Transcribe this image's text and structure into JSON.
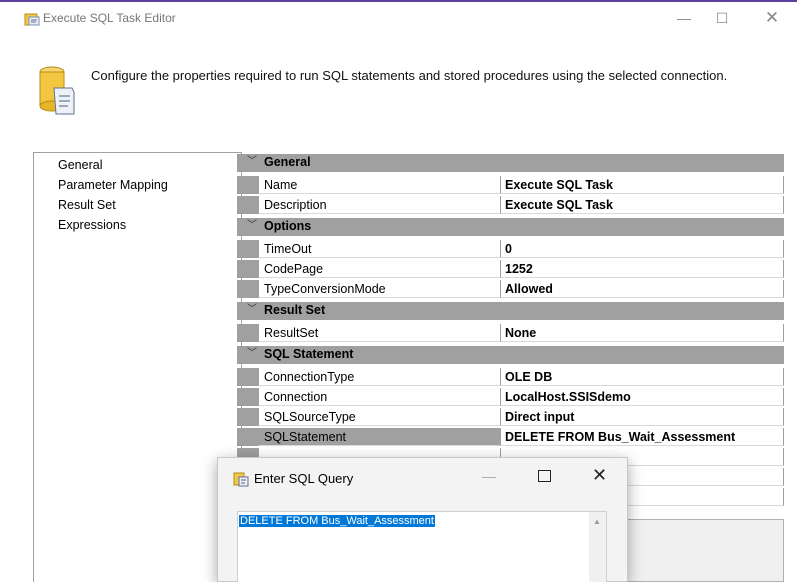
{
  "window": {
    "title": "Execute SQL Task Editor",
    "minimize_glyph": "—",
    "maximize_glyph": "☐",
    "close_glyph": "✕"
  },
  "header": {
    "description": "Configure the properties required to run SQL statements and stored procedures using the selected connection."
  },
  "sidebar": {
    "items": [
      {
        "label": "General"
      },
      {
        "label": "Parameter Mapping"
      },
      {
        "label": "Result Set"
      },
      {
        "label": "Expressions"
      }
    ]
  },
  "properties": {
    "categories": [
      {
        "label": "General",
        "rows": [
          {
            "name": "Name",
            "value": "Execute SQL Task"
          },
          {
            "name": "Description",
            "value": "Execute SQL Task"
          }
        ]
      },
      {
        "label": "Options",
        "rows": [
          {
            "name": "TimeOut",
            "value": "0"
          },
          {
            "name": "CodePage",
            "value": "1252"
          },
          {
            "name": "TypeConversionMode",
            "value": "Allowed"
          }
        ]
      },
      {
        "label": "Result Set",
        "rows": [
          {
            "name": "ResultSet",
            "value": "None"
          }
        ]
      },
      {
        "label": "SQL Statement",
        "rows": [
          {
            "name": "ConnectionType",
            "value": "OLE DB"
          },
          {
            "name": "Connection",
            "value": "LocalHost.SSISdemo"
          },
          {
            "name": "SQLSourceType",
            "value": "Direct input"
          },
          {
            "name": "SQLStatement",
            "value": "DELETE FROM Bus_Wait_Assessment"
          }
        ]
      }
    ],
    "selected_row": "SQLStatement"
  },
  "dialog": {
    "title": "Enter SQL Query",
    "minimize_glyph": "—",
    "close_glyph": "✕",
    "query_text": "DELETE FROM Bus_Wait_Assessment",
    "scroll_up_glyph": "▲"
  },
  "colors": {
    "accent_line": "#5a3f9e",
    "category_background": "#a0a0a0",
    "selection_highlight": "#0078d7"
  }
}
